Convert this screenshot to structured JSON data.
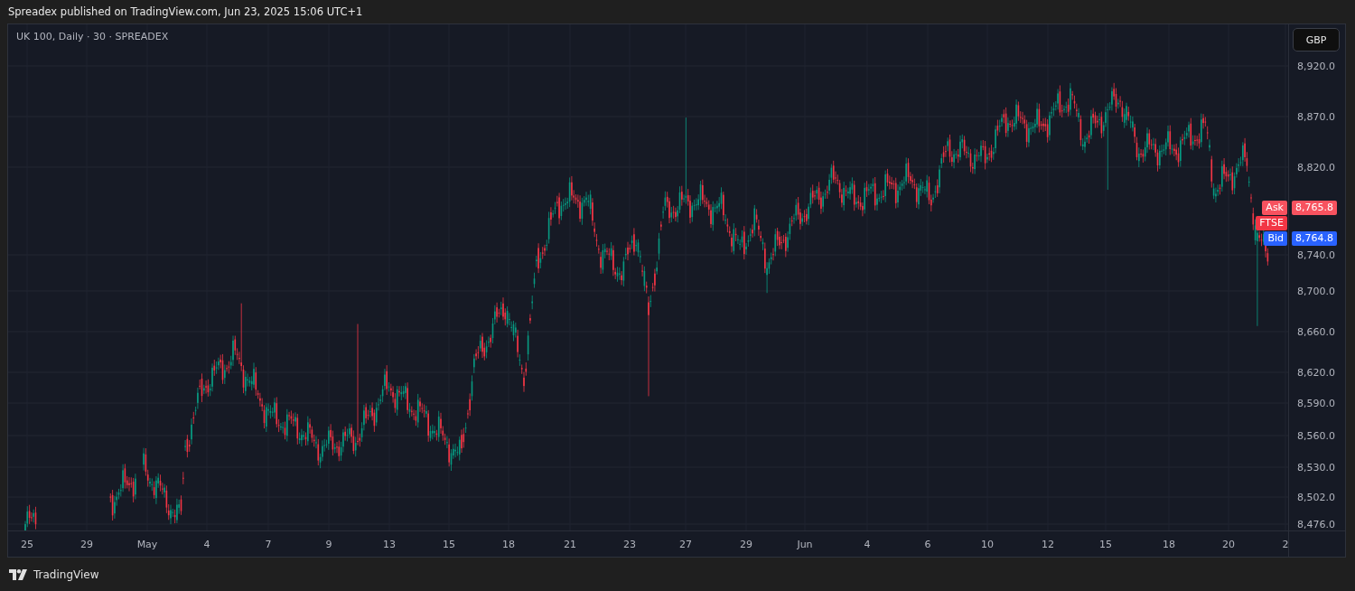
{
  "header": {
    "text": "Spreadex published on TradingView.com, Jun 23, 2025 15:06 UTC+1"
  },
  "chart": {
    "legend": "UK 100, Daily · 30 · SPREADEX",
    "currency_button": "GBP",
    "price_labels": [
      "8,920.0",
      "8,870.0",
      "8,820.0",
      "8,740.0",
      "8,700.0",
      "8,660.0",
      "8,620.0",
      "8,590.0",
      "8,560.0",
      "8,530.0",
      "8,502.0",
      "8,476.0"
    ],
    "time_labels": [
      "25",
      "29",
      "May",
      "4",
      "7",
      "9",
      "13",
      "15",
      "18",
      "21",
      "23",
      "27",
      "29",
      "Jun",
      "4",
      "6",
      "10",
      "12",
      "15",
      "18",
      "20",
      "2"
    ],
    "quote_tags": [
      {
        "kind": "ask",
        "label": "Ask",
        "price": "8,765.8",
        "color": "#f7525f"
      },
      {
        "kind": "symbol",
        "label": "FTSE",
        "color": "#f23645"
      },
      {
        "kind": "bid",
        "label": "Bid",
        "price": "8,764.8",
        "color": "#2962ff"
      }
    ]
  },
  "footer": {
    "brand": "TradingView"
  }
}
